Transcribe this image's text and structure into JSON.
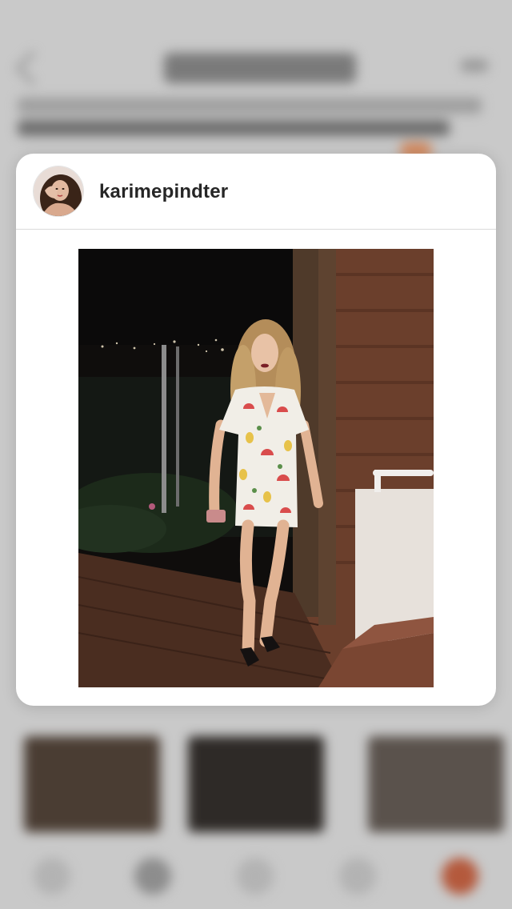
{
  "post_preview": {
    "username": "karimepindter",
    "avatar_icon": "profile-avatar",
    "photo_icon": "post-photo-woman-in-fruit-print-dress"
  },
  "colors": {
    "card_background": "#ffffff",
    "username_text": "#262626",
    "divider": "#dbdbdb",
    "backdrop": "#c9c9c9"
  }
}
